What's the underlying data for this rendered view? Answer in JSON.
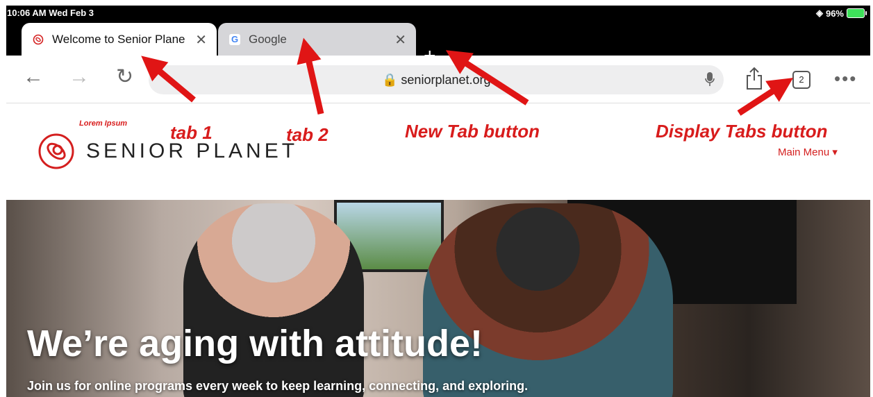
{
  "status": {
    "time": "10:06 AM  Wed Feb 3",
    "battery": "96%"
  },
  "tabs": [
    {
      "title": "Welcome to Senior Plane",
      "close": "✕"
    },
    {
      "title": "Google",
      "close": "✕"
    }
  ],
  "toolbar": {
    "url": "seniorplanet.org",
    "tab_count": "2",
    "back_icon": "back-arrow-icon",
    "forward_icon": "forward-arrow-icon",
    "reload_icon": "reload-icon",
    "mic_icon": "mic-icon",
    "share_icon": "share-icon",
    "more_icon": "more-icon"
  },
  "site": {
    "logo_text": "SENIOR PLANET",
    "menu": "Main Menu ▾",
    "hero_title": "We’re aging with attitude!",
    "hero_subtitle": "Join us for online programs every week to keep learning, connecting, and exploring."
  },
  "annotations": {
    "lorem": "Lorem Ipsum",
    "tab1": "tab 1",
    "tab2": "tab 2",
    "new_tab": "New Tab button",
    "display_tabs": "Display Tabs button"
  },
  "colors": {
    "accent": "#d41f1f",
    "annotation": "#d81c1c"
  }
}
